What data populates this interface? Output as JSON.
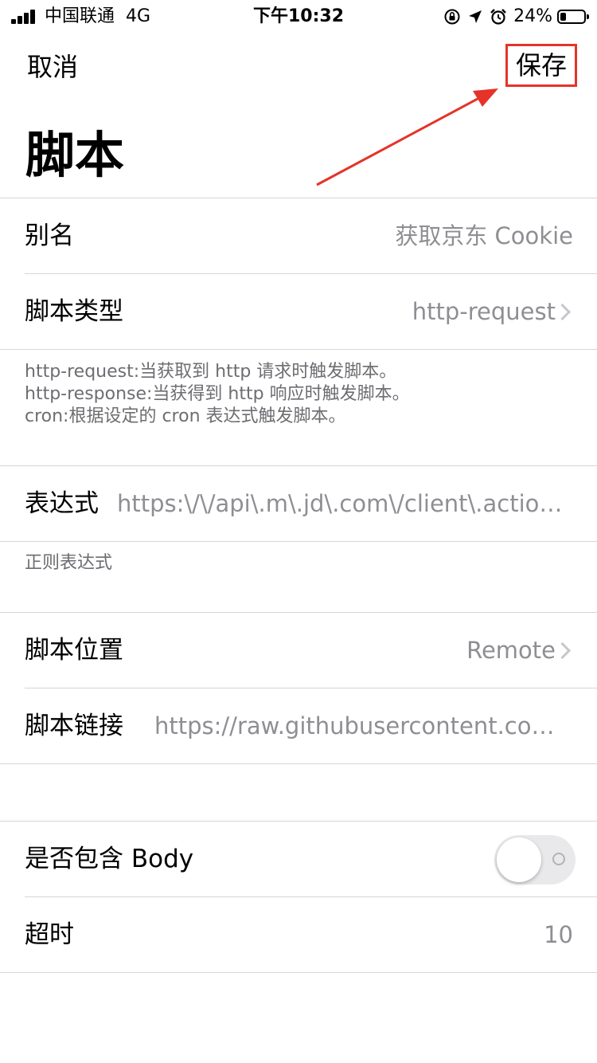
{
  "status_bar": {
    "carrier": "中国联通",
    "network": "4G",
    "time": "下午10:32",
    "battery_percent": "24%",
    "icons": [
      "signal-icon",
      "rotation-lock-icon",
      "location-arrow-icon",
      "alarm-icon",
      "battery-icon"
    ]
  },
  "nav": {
    "cancel_label": "取消",
    "save_label": "保存",
    "highlight_color": "#e53329"
  },
  "page": {
    "title": "脚本"
  },
  "fields": {
    "alias": {
      "label": "别名",
      "placeholder": "获取京东 Cookie"
    },
    "script_type": {
      "label": "脚本类型",
      "value": "http-request"
    },
    "type_help": [
      "http-request:当获取到 http 请求时触发脚本。",
      "http-response:当获得到 http 响应时触发脚本。",
      "cron:根据设定的 cron 表达式触发脚本。"
    ],
    "expression": {
      "label": "表达式",
      "value": "https:\\/\\/api\\.m\\.jd\\.com\\/client\\.action.*f..."
    },
    "expression_help": "正则表达式",
    "script_location": {
      "label": "脚本位置",
      "value": "Remote"
    },
    "script_link": {
      "label": "脚本链接",
      "value": "https://raw.githubusercontent.com/N..."
    },
    "include_body": {
      "label": "是否包含 Body",
      "enabled": false
    },
    "timeout": {
      "label": "超时",
      "value": "10"
    }
  }
}
